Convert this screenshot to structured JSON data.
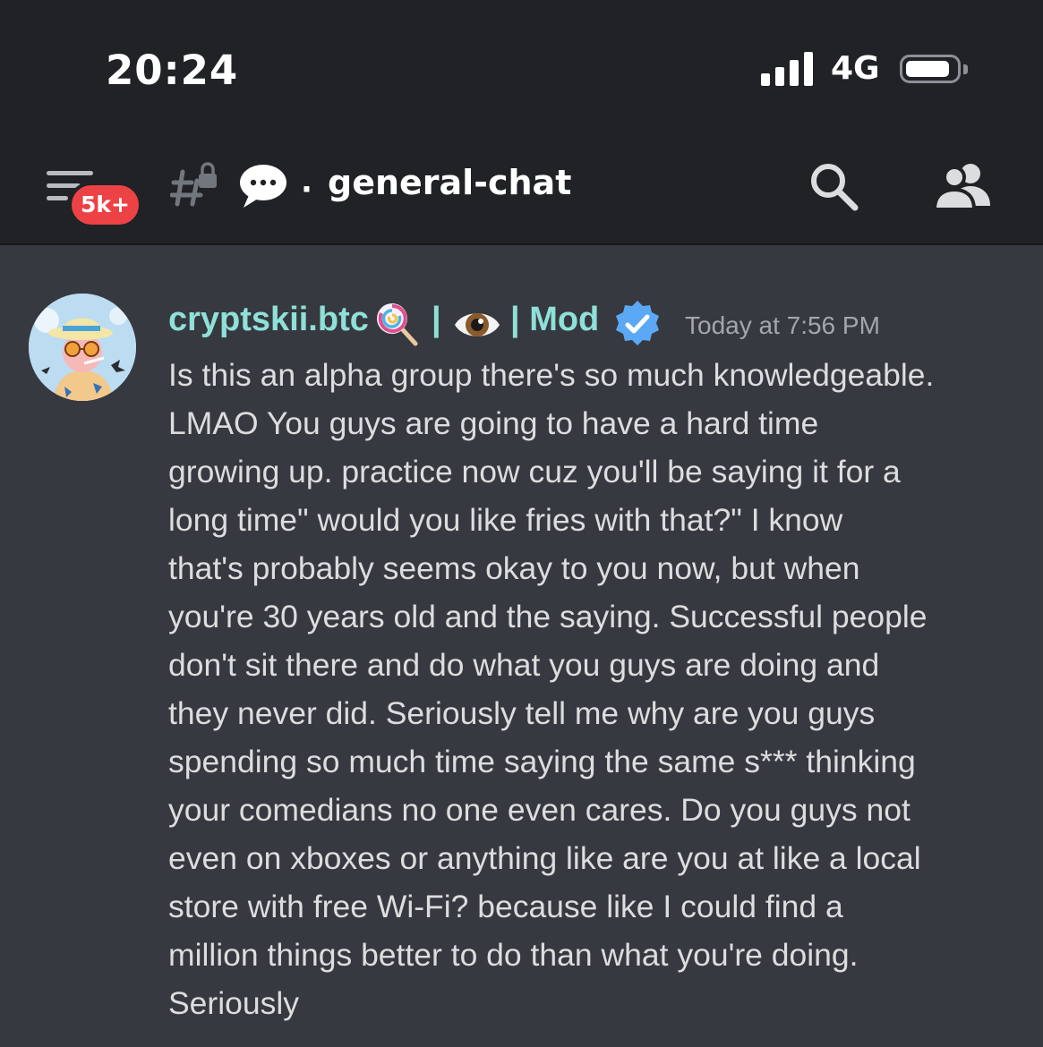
{
  "status_bar": {
    "time": "20:24",
    "network": "4G",
    "signal_bars": 4,
    "battery_level": 0.85
  },
  "header": {
    "notification_badge": "5k+",
    "channel_separator": "·",
    "channel_name": "general-chat"
  },
  "message": {
    "username": "cryptskii.btc",
    "separator": "|",
    "role_label": "| Mod",
    "timestamp": "Today at 7:56 PM",
    "body": "Is this an alpha group there's so much knowledgeable.\nLMAO You guys are going to have a hard time\ngrowing up.  practice now cuz you'll be saying it for a\nlong time\" would you like fries with that?\" I know\nthat's probably seems okay to you now, but when\nyou're 30 years old and the saying.  Successful people\ndon't sit there and do what you guys are doing and\nthey never did. Seriously tell me why are you guys\nspending so much time saying the same s*** thinking\nyour comedians no one even cares. Do you guys not\neven on xboxes or anything like are you at like a local\nstore with free Wi-Fi? because like I could find a\nmillion things better to do than what you're doing.\nSeriously"
  },
  "colors": {
    "background": "#36393f",
    "header_bg": "#202225",
    "username": "#8fe0d8",
    "badge": "#ed4245",
    "verified": "#5865f2",
    "body_text": "#dcddde",
    "timestamp": "#a3a6aa"
  },
  "icons": {
    "menu": "hamburger-menu-icon",
    "channel_type": "locked-hash-icon",
    "thread": "speech-bubble-icon",
    "search": "search-icon",
    "members": "members-icon",
    "badge_emoji_1": "lollipop-icon",
    "badge_emoji_2": "eye-icon",
    "verified": "verified-icon"
  }
}
